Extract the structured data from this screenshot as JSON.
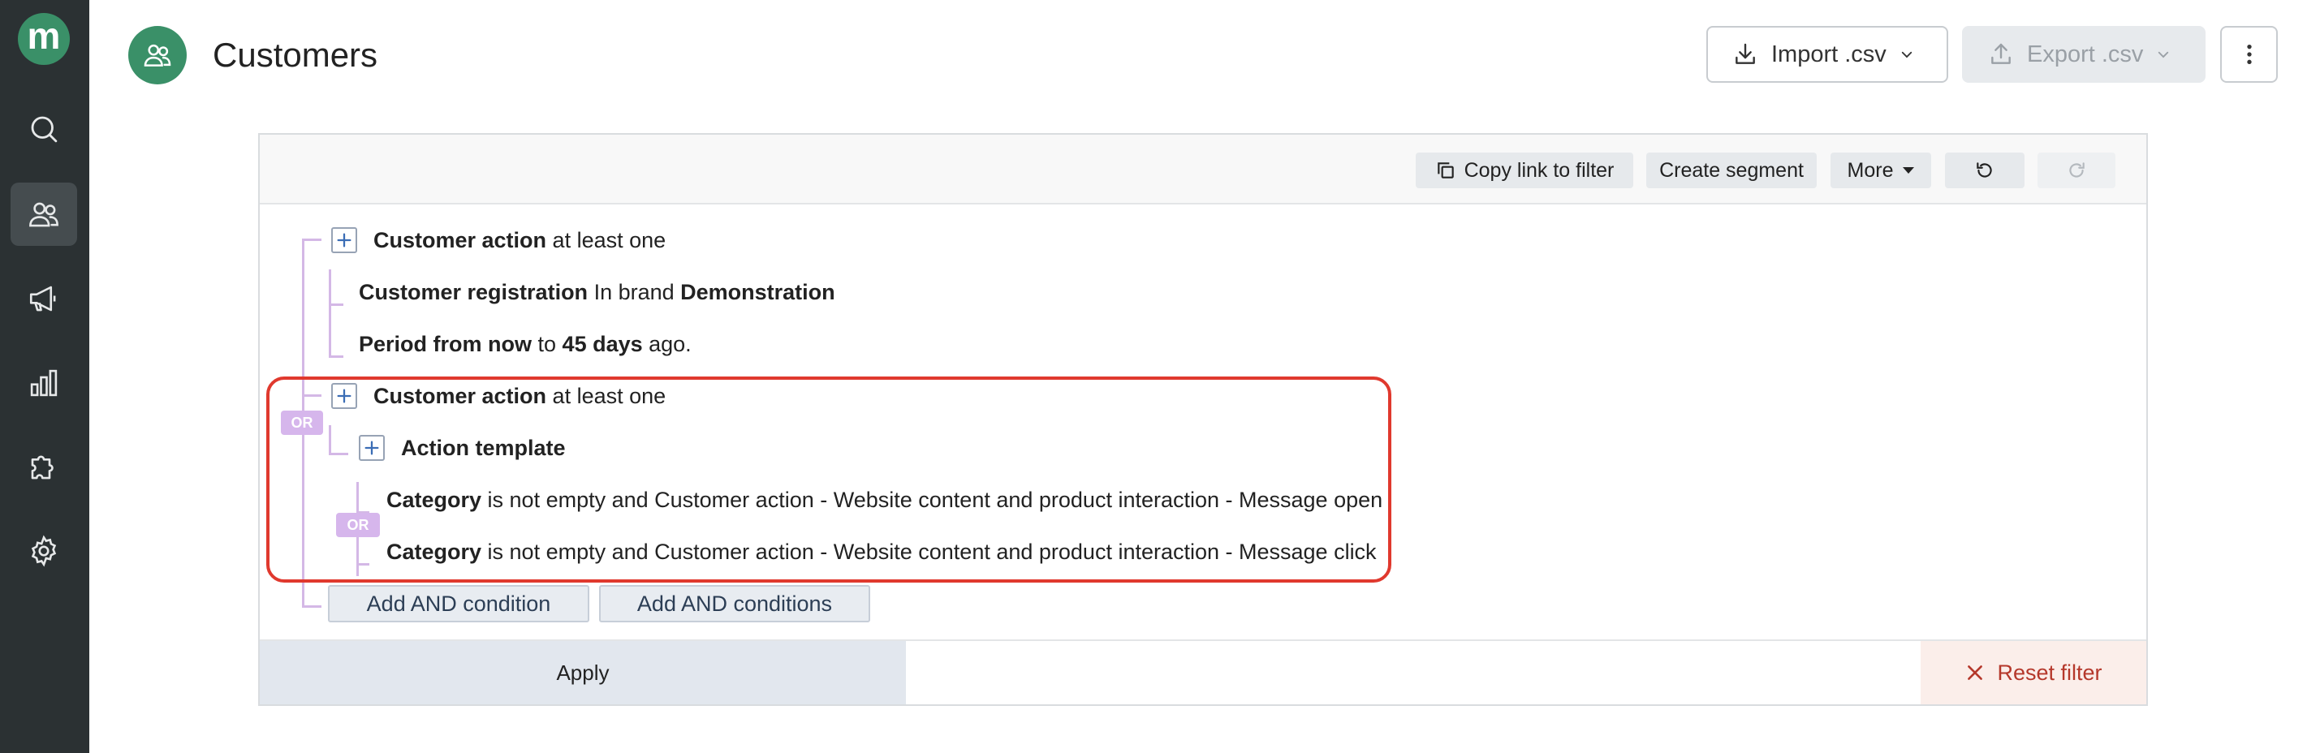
{
  "app": {
    "logo_letter": "m",
    "accent": "#3a9068",
    "sidebar_bg": "#2b3133"
  },
  "sidebar": {
    "items": [
      {
        "name": "search",
        "icon": "search-icon",
        "active": false
      },
      {
        "name": "customers",
        "icon": "users-icon",
        "active": true
      },
      {
        "name": "campaigns",
        "icon": "megaphone-icon",
        "active": false
      },
      {
        "name": "analytics",
        "icon": "bar-chart-icon",
        "active": false
      },
      {
        "name": "integrations",
        "icon": "puzzle-icon",
        "active": false
      },
      {
        "name": "settings",
        "icon": "gear-icon",
        "active": false
      }
    ]
  },
  "header": {
    "title": "Customers",
    "import_label": "Import .csv",
    "export_label": "Export .csv"
  },
  "toolbar": {
    "copy_link_label": "Copy link to filter",
    "create_segment_label": "Create segment",
    "more_label": "More"
  },
  "filter": {
    "or_label": "OR",
    "rows": [
      {
        "bold": "Customer action",
        "rest": " at least one"
      },
      {
        "bold": "Customer registration",
        "mid": " In brand ",
        "bold2": "Demonstration"
      },
      {
        "bold": "Period from now",
        "mid": " to ",
        "bold2": "45 days",
        "rest": " ago."
      },
      {
        "bold": "Customer action",
        "rest": " at least one"
      },
      {
        "bold": "Action template"
      },
      {
        "bold": "Category",
        "rest": " is not empty and Customer action - Website content and product interaction - Message open"
      },
      {
        "bold": "Category",
        "rest": " is not empty and Customer action - Website content and product interaction - Message click"
      }
    ],
    "add_and_condition_label": "Add AND condition",
    "add_and_conditions_label": "Add AND conditions"
  },
  "footer": {
    "apply_label": "Apply",
    "reset_label": "Reset filter"
  },
  "colors": {
    "tree_line": "#d4b8e6",
    "or_badge": "#d6b6ec",
    "highlight": "#e0392e",
    "reset_text": "#b5382b"
  }
}
